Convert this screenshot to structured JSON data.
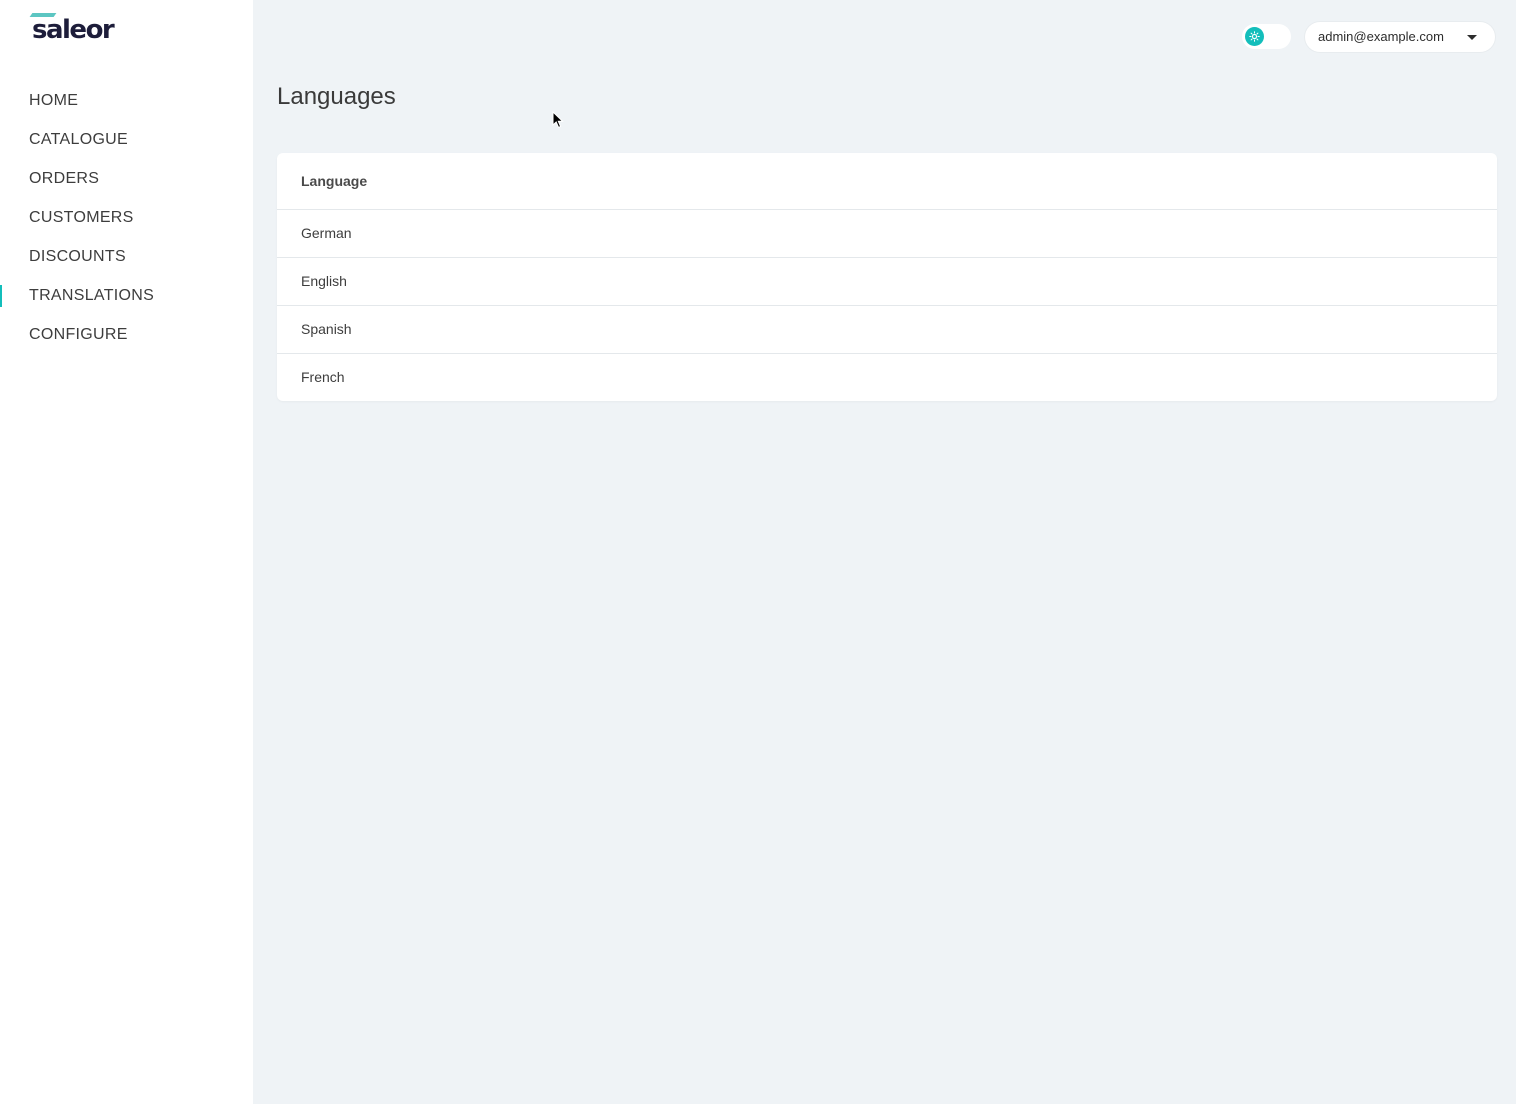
{
  "app": {
    "logo_text": "saleor",
    "brand_color": "#13bebb",
    "logo_text_color": "#1d1d3a"
  },
  "sidebar": {
    "items": [
      {
        "label": "HOME",
        "active": false
      },
      {
        "label": "CATALOGUE",
        "active": false
      },
      {
        "label": "ORDERS",
        "active": false
      },
      {
        "label": "CUSTOMERS",
        "active": false
      },
      {
        "label": "DISCOUNTS",
        "active": false
      },
      {
        "label": "TRANSLATIONS",
        "active": true
      },
      {
        "label": "CONFIGURE",
        "active": false
      }
    ]
  },
  "header": {
    "theme_toggle_icon": "sun-icon",
    "theme_toggle_state": "light",
    "user_email": "admin@example.com",
    "user_menu_icon": "caret-down-icon"
  },
  "main": {
    "title": "Languages",
    "table": {
      "header": "Language",
      "rows": [
        "German",
        "English",
        "Spanish",
        "French"
      ]
    }
  }
}
